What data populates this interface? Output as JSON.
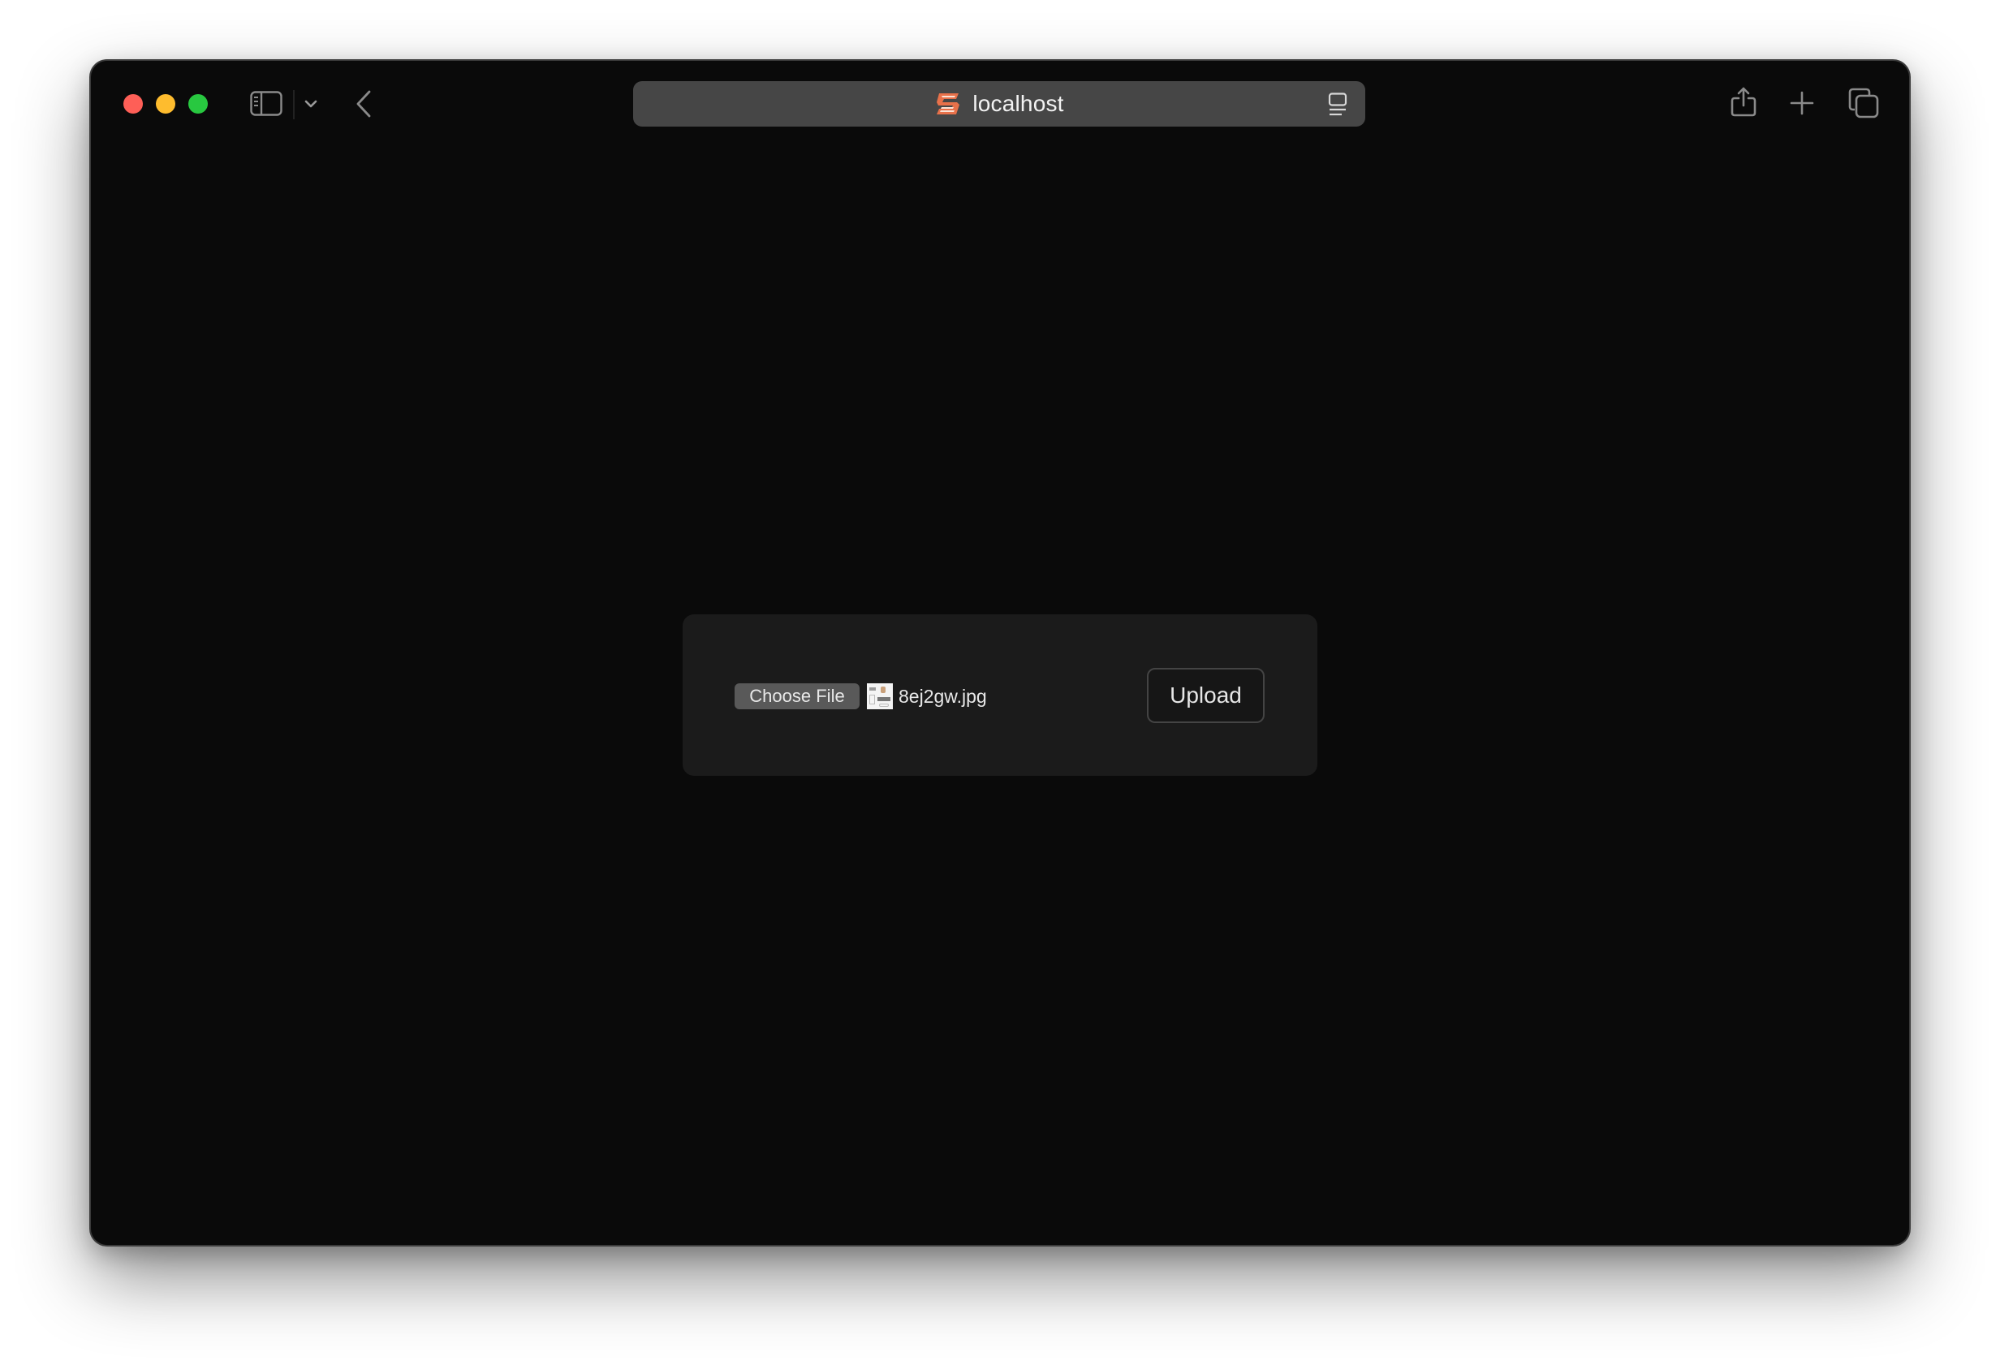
{
  "browser": {
    "window_controls": {
      "close": "close-button",
      "minimize": "minimize-button",
      "zoom": "zoom-button"
    },
    "toolbar_icons": {
      "sidebar": "sidebar-icon",
      "tab_group_menu": "chevron-down-icon",
      "back": "chevron-left-icon",
      "reader": "reader-icon",
      "share": "share-icon",
      "new_tab": "plus-icon",
      "tab_overview": "tabs-icon"
    },
    "address_bar": {
      "url": "localhost",
      "favicon": "favicon-icon"
    },
    "colors": {
      "window_bg": "#0a0a0a",
      "address_bar_bg": "#464646",
      "close": "#fe5f57",
      "minimize": "#febc2e",
      "zoom": "#28c840",
      "favicon": "#e8714a"
    }
  },
  "page": {
    "upload_form": {
      "choose_file_label": "Choose File",
      "selected_file_name": "8ej2gw.jpg",
      "upload_label": "Upload"
    },
    "colors": {
      "panel_bg": "#1b1b1b",
      "choose_button_bg": "#595959",
      "upload_border": "#444444"
    }
  }
}
